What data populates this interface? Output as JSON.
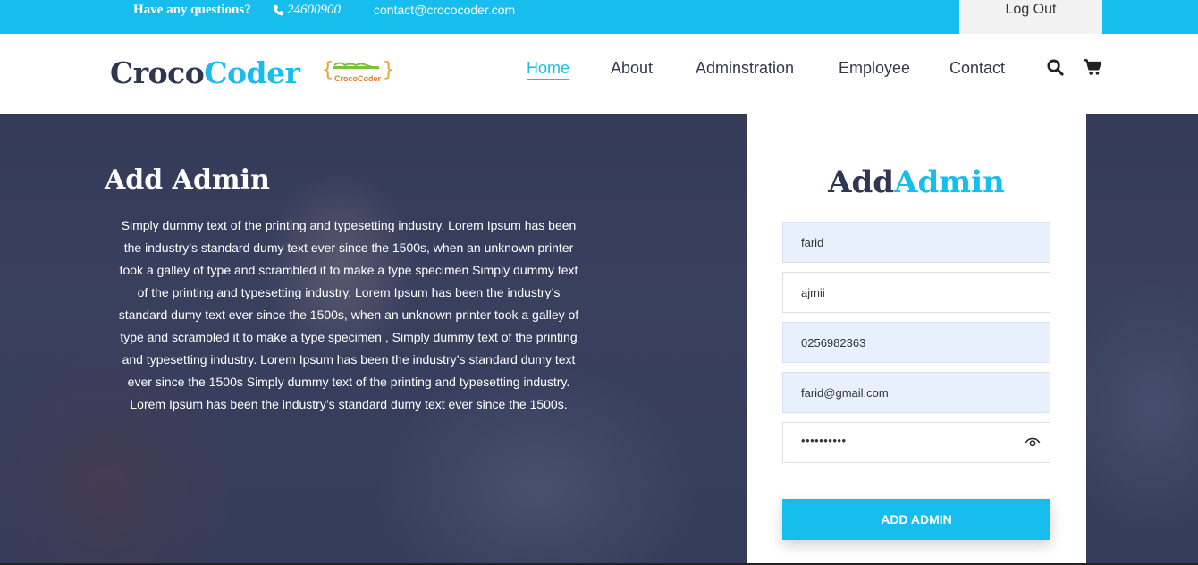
{
  "topbar": {
    "question": "Have any questions?",
    "phone": "24600900",
    "email": "contact@crococoder.com",
    "logout": "Log Out"
  },
  "brand": {
    "part1": "Croco",
    "part2": "Coder",
    "logo_text": "CrocoCoder"
  },
  "nav": {
    "items": [
      {
        "label": "Home",
        "active": true
      },
      {
        "label": "About"
      },
      {
        "label": "Adminstration"
      },
      {
        "label": "Employee"
      },
      {
        "label": "Contact"
      }
    ],
    "icons": [
      "search-icon",
      "cart-icon"
    ]
  },
  "hero": {
    "title": "Add Admin",
    "text": "Simply dummy text of the printing and typesetting industry. Lorem Ipsum has been the industry’s standard dumy text ever since the 1500s, when an unknown printer took a galley of type and scrambled it to make a type specimen Simply dummy text of the printing and typesetting industry. Lorem Ipsum has been the industry’s standard dumy text ever since the 1500s, when an unknown printer took a galley of type and scrambled it to make a type specimen , Simply dummy text of the printing and typesetting industry. Lorem Ipsum has been the industry’s standard dumy text ever since the 1500s Simply dummy text of the printing and typesetting industry. Lorem Ipsum has been the industry’s standard dumy text ever since the 1500s."
  },
  "form": {
    "title_part1": "Add",
    "title_part2": "Admin",
    "first_name": "farid",
    "last_name": "ajmii",
    "phone": "0256982363",
    "email": "farid@gmail.com",
    "password_mask": "••••••••••",
    "submit": "ADD ADMIN"
  },
  "colors": {
    "accent": "#17bdec",
    "dark": "#2f3650",
    "input_filled": "#e8f0fe"
  }
}
